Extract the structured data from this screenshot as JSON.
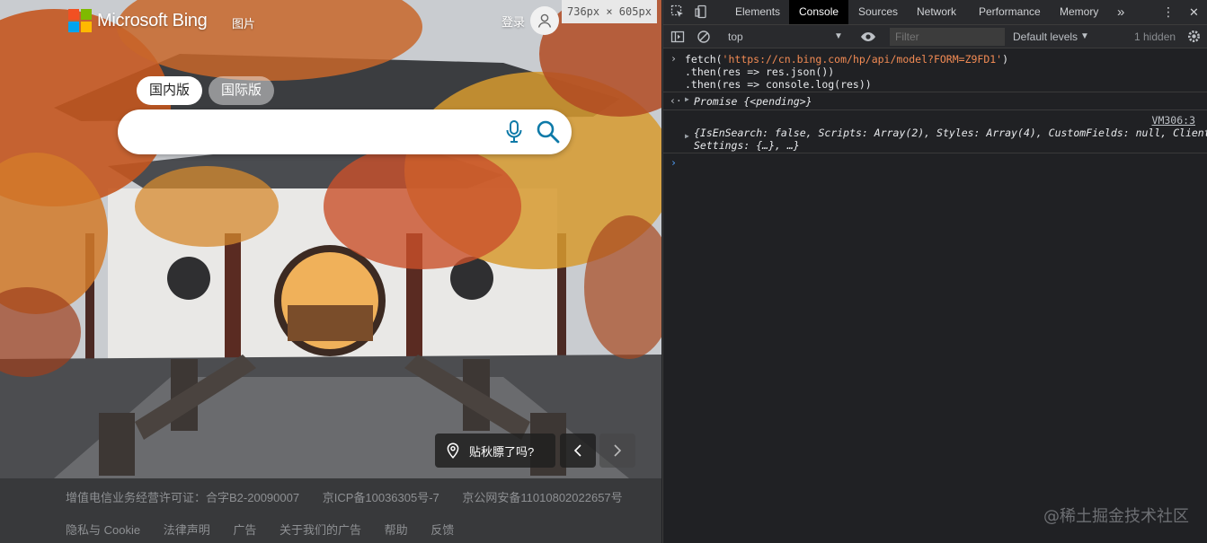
{
  "bing": {
    "logo_text": "Microsoft Bing",
    "nav_images": "图片",
    "signin": "登录",
    "size_tag": "736px × 605px",
    "market_tabs": [
      "国内版",
      "国际版"
    ],
    "search": {
      "value": "",
      "placeholder": ""
    },
    "caption": "贴秋膘了吗?",
    "footer": {
      "row1": [
        "增值电信业务经营许可证：合字B2-20090007",
        "京ICP备10036305号-7",
        "京公网安备11010802022657号"
      ],
      "row2": [
        "隐私与 Cookie",
        "法律声明",
        "广告",
        "关于我们的广告",
        "帮助",
        "反馈"
      ]
    },
    "logo_colors": [
      "#f25022",
      "#7fba00",
      "#00a4ef",
      "#ffb900"
    ],
    "accent": "#0e7aa8"
  },
  "devtools": {
    "tabs": [
      "Elements",
      "Console",
      "Sources",
      "Network",
      "Performance",
      "Memory"
    ],
    "active_tab": "Console",
    "context": "top",
    "filter_placeholder": "Filter",
    "levels": "Default levels",
    "hidden": "1 hidden",
    "console": {
      "input_lines": [
        {
          "pre": "fetch(",
          "str": "'https://cn.bing.com/hp/api/model?FORM=Z9FD1'",
          "post": ")"
        },
        {
          "pre": ".then(res => res.json())",
          "str": "",
          "post": ""
        },
        {
          "pre": ".then(res => console.log(res))",
          "str": "",
          "post": ""
        }
      ],
      "promise_result": "Promise {<pending>}",
      "source_link": "VM306:3",
      "log_line1": "{IsEnSearch: false, Scripts: Array(2), Styles: Array(4), CustomFields: null, Client",
      "log_line2": "Settings: {…}, …}"
    }
  },
  "watermark": "@稀土掘金技术社区"
}
